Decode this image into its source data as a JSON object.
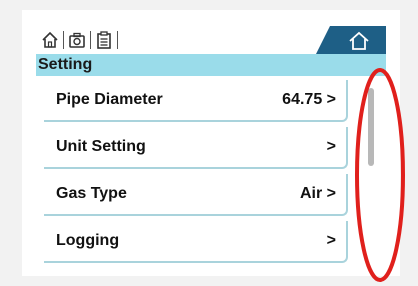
{
  "title": "Setting",
  "topbar": {
    "icons": [
      "home-icon",
      "camera-icon",
      "clipboard-icon"
    ],
    "home_tab_icon": "home-icon"
  },
  "menu": {
    "items": [
      {
        "label": "Pipe Diameter",
        "value": "64.75 >"
      },
      {
        "label": "Unit Setting",
        "value": ">"
      },
      {
        "label": "Gas Type",
        "value": "Air >"
      },
      {
        "label": "Logging",
        "value": ">"
      }
    ]
  },
  "scroll": {
    "position_fraction": 0.0,
    "visible_fraction": 0.4
  },
  "colors": {
    "title_bar": "#9adcea",
    "item_border": "#a9d3dc",
    "annotation": "#e0201c",
    "scroll_thumb": "#b8b8b8"
  }
}
